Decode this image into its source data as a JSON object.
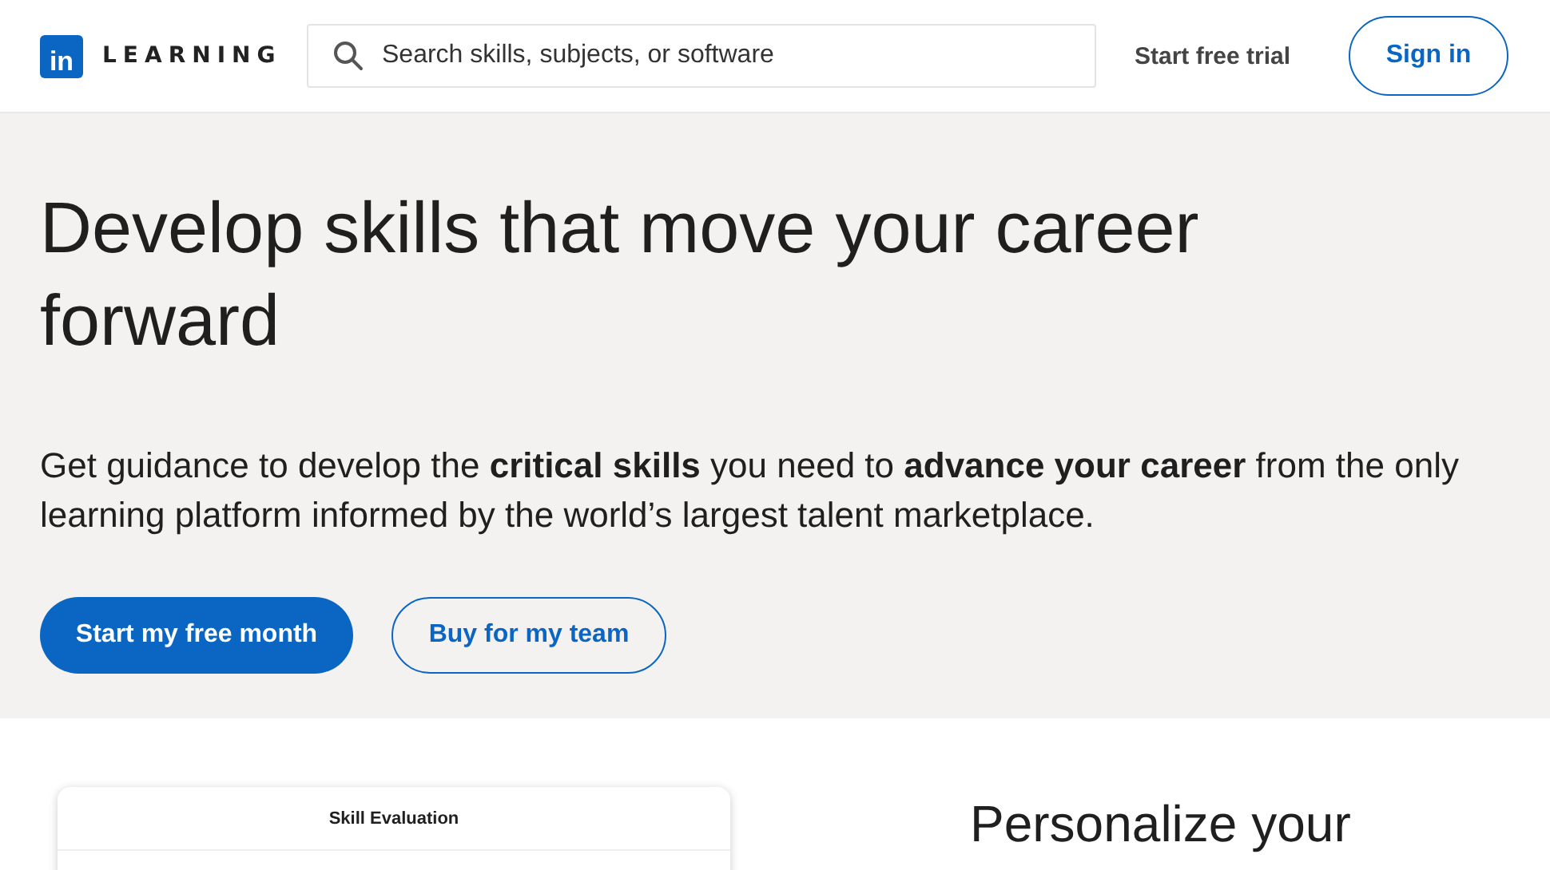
{
  "header": {
    "logo_mark": "in",
    "logo_text": "LEARNING",
    "search": {
      "placeholder": "Search skills, subjects, or software"
    },
    "trial_link": "Start free trial",
    "sign_in": "Sign in"
  },
  "hero": {
    "title": "Develop skills that move your career forward",
    "subtitle": "Get guidance to develop the **critical skills** you need to **advance your career** from the only learning platform informed by the world’s largest talent marketplace.",
    "buttons": [
      {
        "label": "Start my free month",
        "kind": "primary"
      },
      {
        "label": "Buy for my team",
        "kind": "secondary"
      }
    ]
  },
  "preview": {
    "card_title": "Skill Evaluation",
    "heading": "Personalize your"
  }
}
